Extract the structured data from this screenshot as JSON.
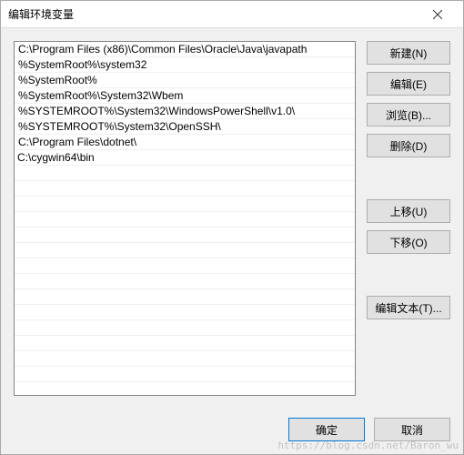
{
  "window": {
    "title": "编辑环境变量"
  },
  "path_entries": [
    "C:\\Program Files (x86)\\Common Files\\Oracle\\Java\\javapath",
    "%SystemRoot%\\system32",
    "%SystemRoot%",
    "%SystemRoot%\\System32\\Wbem",
    "%SYSTEMROOT%\\System32\\WindowsPowerShell\\v1.0\\",
    "%SYSTEMROOT%\\System32\\OpenSSH\\",
    "C:\\Program Files\\dotnet\\",
    "C:\\cygwin64\\bin"
  ],
  "selected_index": 7,
  "editing_value": "C:\\cygwin64\\bin",
  "buttons": {
    "new": "新建(N)",
    "edit": "编辑(E)",
    "browse": "浏览(B)...",
    "delete": "删除(D)",
    "move_up": "上移(U)",
    "move_down": "下移(O)",
    "edit_text": "编辑文本(T)...",
    "ok": "确定",
    "cancel": "取消"
  },
  "watermark": "https://blog.csdn.net/Baron_wu"
}
